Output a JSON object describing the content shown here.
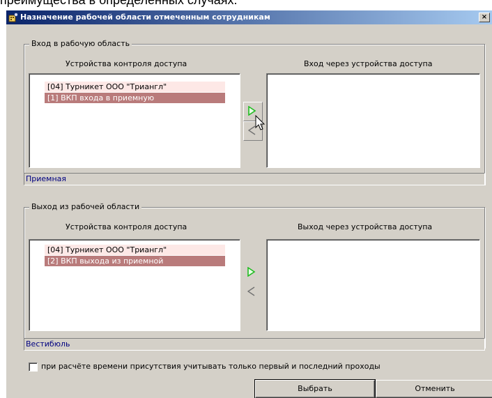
{
  "background_text": "преимущества в определенных случаях.",
  "window": {
    "title": "Назначение рабочей области отмеченным сотрудникам",
    "close_glyph": "×"
  },
  "entry": {
    "group_label": "Вход в рабочую область",
    "left_header": "Устройства контроля доступа",
    "right_header": "Вход через устройства доступа",
    "left_items": [
      {
        "label": "[04] Турникет ООО \"Триангл\"",
        "selected": false
      },
      {
        "label": "[1] ВКП входа в приемную",
        "selected": true
      }
    ],
    "right_items": [],
    "status": "Приемная"
  },
  "exit": {
    "group_label": "Выход из рабочей области",
    "left_header": "Устройства контроля доступа",
    "right_header": "Выход через устройства доступа",
    "left_items": [
      {
        "label": "[04] Турникет ООО \"Триангл\"",
        "selected": false
      },
      {
        "label": "[2] ВКП выхода из приемной",
        "selected": true
      }
    ],
    "right_items": [],
    "status": "Вестибюль"
  },
  "icons": {
    "add": "arrow-right-icon",
    "remove": "arrow-left-icon",
    "title": "dialog-app-icon"
  },
  "checkbox": {
    "label": "при расчёте времени присутствия учитывать только первый и последний проходы",
    "checked": false
  },
  "buttons": {
    "ok": "Выбрать",
    "cancel": "Отменить"
  },
  "colors": {
    "dialog_bg": "#d4d0c8",
    "title_gradient_start": "#0a246a",
    "selected_item": "#b97b7b",
    "unselected_item": "#fde8e6",
    "arrow_green": "#22bb22",
    "status_text": "#000080"
  }
}
